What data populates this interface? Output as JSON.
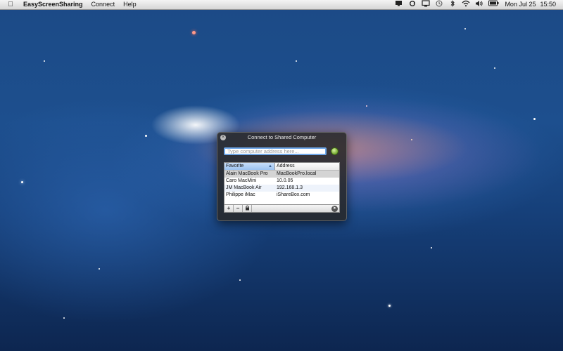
{
  "menubar": {
    "apple_icon": "apple-logo-icon",
    "app_name": "EasyScreenSharing",
    "menus": [
      "Connect",
      "Help"
    ],
    "status_icons": [
      "screen-icon",
      "sync-icon",
      "display-icon",
      "time-machine-icon",
      "bluetooth-icon",
      "wifi-icon",
      "volume-icon",
      "battery-icon"
    ],
    "clock": {
      "day": "Mon Jul 25",
      "time": "15:50"
    }
  },
  "window": {
    "title": "Connect to Shared Computer",
    "address_placeholder": "Type computer address here...",
    "address_value": "",
    "columns": {
      "favorite": "Favorite",
      "address": "Address"
    },
    "rows": [
      {
        "favorite": "Alain MacBook Pro",
        "address": "MacBookPro.local"
      },
      {
        "favorite": "Caro MacMini",
        "address": "10.0.05"
      },
      {
        "favorite": "JM MacBook Air",
        "address": "192.168.1.3"
      },
      {
        "favorite": "Philippe iMac",
        "address": "iShareBox.com"
      }
    ],
    "bottom_buttons": {
      "add": "+",
      "remove": "−"
    }
  },
  "colors": {
    "input_focus": "#6fa7e8",
    "go_button": "#7fb23c",
    "selected_row": "#d4d4d4",
    "header_sorted": "#9cc2ef"
  }
}
